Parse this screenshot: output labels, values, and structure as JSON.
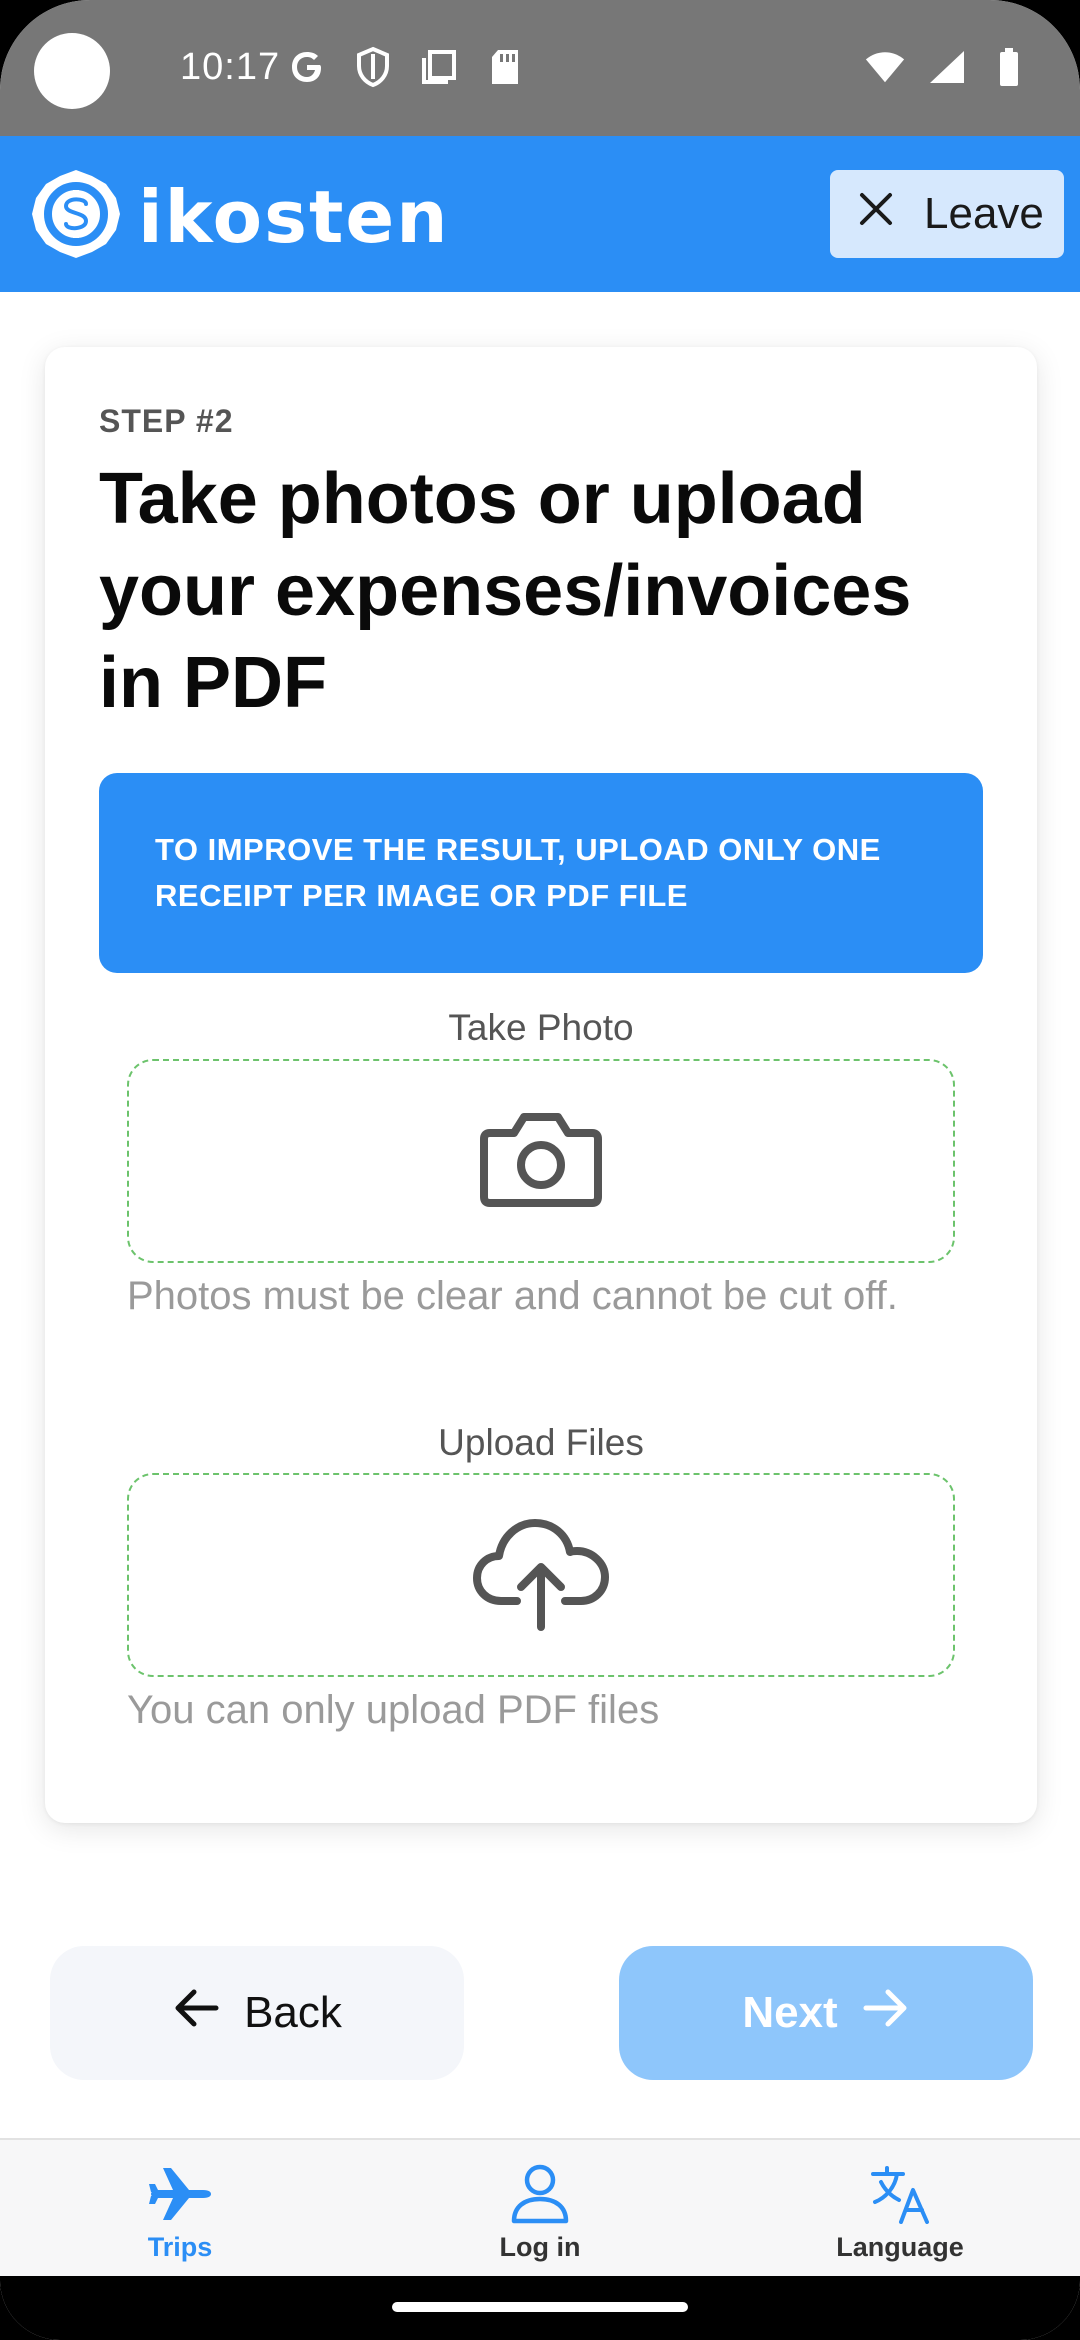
{
  "status_bar": {
    "time": "10:17",
    "icons_left": [
      "google-g-icon",
      "shield-icon",
      "copy-icon",
      "sd-card-icon"
    ],
    "icons_right": [
      "wifi-icon",
      "signal-icon",
      "battery-icon"
    ]
  },
  "header": {
    "logo_text": "ikosten",
    "leave_label": "Leave",
    "color": "#2b8ef5"
  },
  "card": {
    "step_label": "STEP #2",
    "title": "Take photos or upload your expenses/invoices in PDF",
    "notice": "TO IMPROVE THE RESULT, UPLOAD ONLY ONE RECEIPT PER IMAGE OR PDF FILE",
    "photo": {
      "label": "Take Photo",
      "hint": "Photos must be clear and cannot be cut off.",
      "icon": "camera-icon"
    },
    "upload": {
      "label": "Upload Files",
      "hint": "You can only upload PDF files",
      "icon": "cloud-upload-icon"
    }
  },
  "actions": {
    "back_label": "Back",
    "next_label": "Next",
    "next_enabled": false
  },
  "bottom_nav": {
    "items": [
      {
        "label": "Trips",
        "icon": "airplane-icon",
        "active": true
      },
      {
        "label": "Log in",
        "icon": "user-icon",
        "active": false
      },
      {
        "label": "Language",
        "icon": "translate-icon",
        "active": false
      }
    ]
  },
  "colors": {
    "accent": "#2b8ef5",
    "accent_disabled": "#8ec6fb",
    "dropzone_border": "#6cc36c"
  }
}
